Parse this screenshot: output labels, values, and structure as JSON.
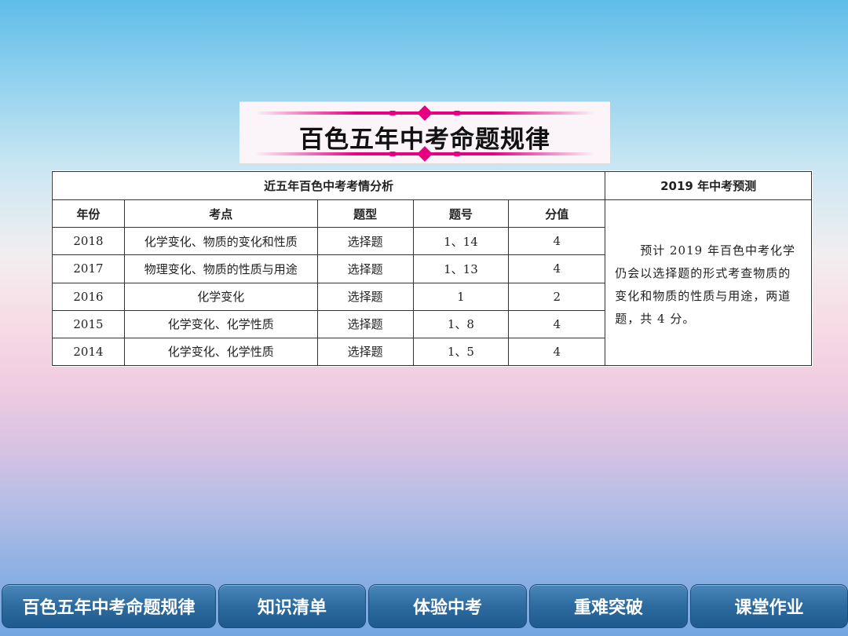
{
  "title": "百色五年中考命题规律",
  "table": {
    "analysis_header": "近五年百色中考考情分析",
    "prediction_header": "2019 年中考预测",
    "columns": [
      "年份",
      "考点",
      "题型",
      "题号",
      "分值"
    ],
    "rows": [
      {
        "year": "2018",
        "topic": "化学变化、物质的变化和性质",
        "type": "选择题",
        "number": "1、14",
        "score": "4"
      },
      {
        "year": "2017",
        "topic": "物理变化、物质的性质与用途",
        "type": "选择题",
        "number": "1、13",
        "score": "4"
      },
      {
        "year": "2016",
        "topic": "化学变化",
        "type": "选择题",
        "number": "1",
        "score": "2"
      },
      {
        "year": "2015",
        "topic": "化学变化、化学性质",
        "type": "选择题",
        "number": "1、8",
        "score": "4"
      },
      {
        "year": "2014",
        "topic": "化学变化、化学性质",
        "type": "选择题",
        "number": "1、5",
        "score": "4"
      }
    ],
    "prediction_text": "　　预计 2019 年百色中考化学仍会以选择题的形式考查物质的变化和物质的性质与用途，两道题，共 4 分。"
  },
  "nav": [
    "百色五年中考命题规律",
    "知识清单",
    "体验中考",
    "重难突破",
    "课堂作业"
  ],
  "colors": {
    "accent": "#e4007f",
    "nav": "#2d6b9f"
  }
}
